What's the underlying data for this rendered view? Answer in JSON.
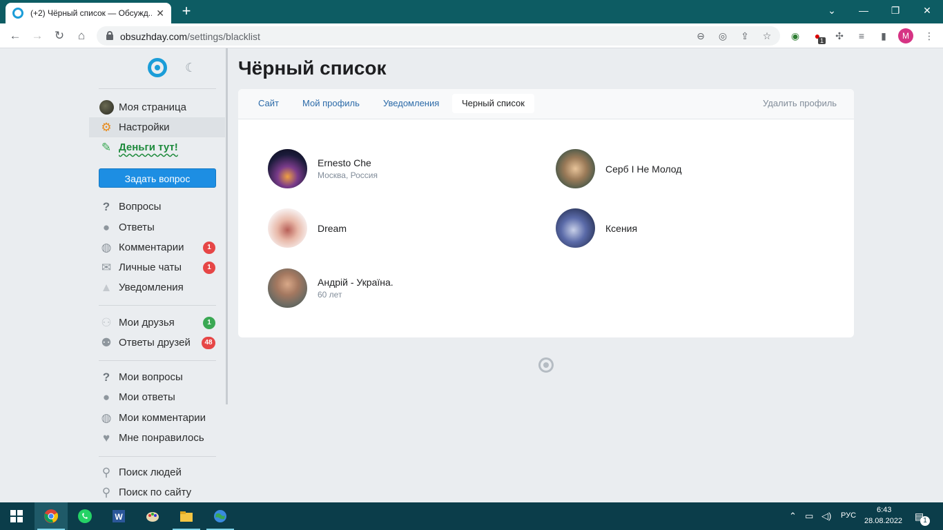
{
  "browser": {
    "tab_title": "(+2) Чёрный список — Обсужд...",
    "tab_close": "✕",
    "new_tab": "+",
    "url_host": "obsuzhday.com",
    "url_path": "/settings/blacklist",
    "profile_initial": "M",
    "extension_badge": "1"
  },
  "sidebar": {
    "items": [
      {
        "label": "Моя страница",
        "icon": "user-avatar-icon"
      },
      {
        "label": "Настройки",
        "icon": "gears-icon"
      },
      {
        "label": "Деньги тут!",
        "icon": "money-icon"
      },
      {
        "label": "Вопросы",
        "icon": "question-icon"
      },
      {
        "label": "Ответы",
        "icon": "speech-bubble-icon"
      },
      {
        "label": "Комментарии",
        "icon": "comments-icon",
        "badge": "1"
      },
      {
        "label": "Личные чаты",
        "icon": "envelope-icon",
        "badge": "1"
      },
      {
        "label": "Уведомления",
        "icon": "bell-icon"
      },
      {
        "label": "Мои друзья",
        "icon": "friends-icon",
        "badge": "1"
      },
      {
        "label": "Ответы друзей",
        "icon": "friends-answers-icon",
        "badge": "48"
      },
      {
        "label": "Мои вопросы",
        "icon": "question-icon"
      },
      {
        "label": "Мои ответы",
        "icon": "speech-bubble-icon"
      },
      {
        "label": "Мои комментарии",
        "icon": "comments-icon"
      },
      {
        "label": "Мне понравилось",
        "icon": "heart-icon"
      },
      {
        "label": "Поиск людей",
        "icon": "people-search-icon"
      },
      {
        "label": "Поиск по сайту",
        "icon": "search-icon"
      }
    ],
    "ask_button": "Задать вопрос"
  },
  "main": {
    "title": "Чёрный список",
    "tabs": [
      {
        "label": "Сайт"
      },
      {
        "label": "Мой профиль"
      },
      {
        "label": "Уведомления"
      },
      {
        "label": "Черный список",
        "active": true
      }
    ],
    "delete_profile": "Удалить профиль",
    "people": [
      {
        "name": "Ernesto Che",
        "sub": "Москва, Россия"
      },
      {
        "name": "Серб I Не Молод",
        "sub": ""
      },
      {
        "name": "Dream",
        "sub": ""
      },
      {
        "name": "Ксения",
        "sub": ""
      },
      {
        "name": "Андрій - Україна.",
        "sub": "60 лет"
      }
    ]
  },
  "taskbar": {
    "lang": "РУС",
    "time": "6:43",
    "date": "28.08.2022",
    "notification_count": "1"
  },
  "colors": {
    "accent": "#1b9dd8",
    "button": "#1d8ee3",
    "badge_red": "#e64646",
    "badge_green": "#3aa853",
    "tabstrip": "#0d5c63",
    "taskbar": "#0b3d4a"
  }
}
